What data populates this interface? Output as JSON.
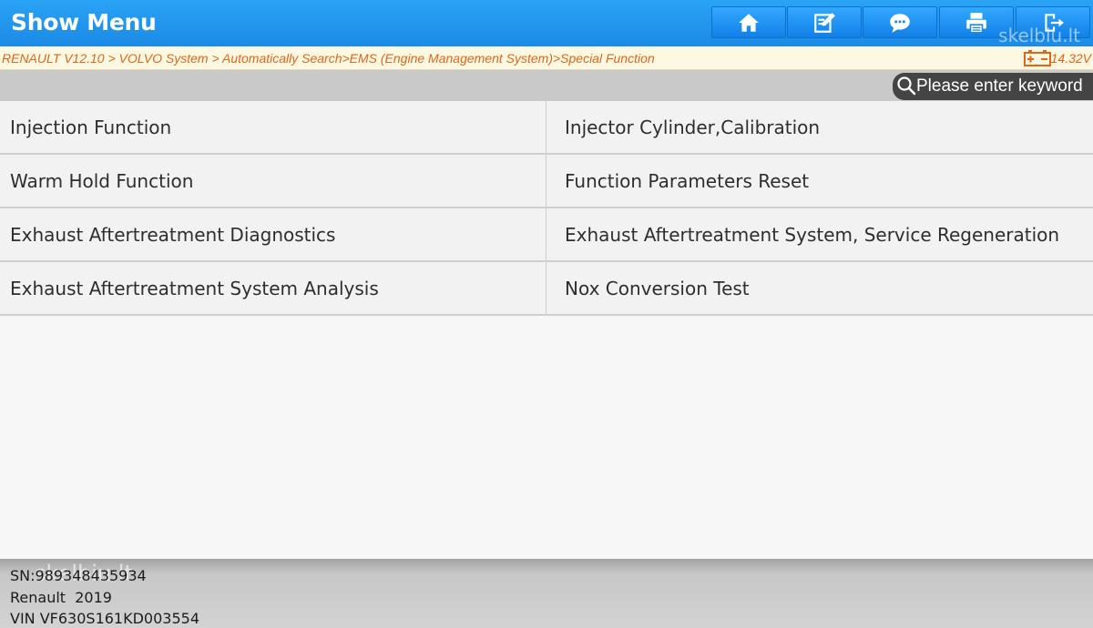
{
  "header": {
    "title": "Show Menu",
    "buttons": [
      {
        "name": "home",
        "icon": "home-icon"
      },
      {
        "name": "report",
        "icon": "edit-icon"
      },
      {
        "name": "feedback",
        "icon": "chat-icon"
      },
      {
        "name": "print",
        "icon": "print-icon"
      },
      {
        "name": "exit",
        "icon": "exit-icon"
      }
    ],
    "watermark": "skelbiu.lt"
  },
  "breadcrumb": {
    "path": "RENAULT V12.10 > VOLVO System > Automatically Search>EMS (Engine Management System)>Special Function",
    "battery_icon": "battery-icon",
    "voltage": "14.32V"
  },
  "search": {
    "placeholder": "Please enter keyword"
  },
  "menu": {
    "items": [
      "Injection Function",
      "Injector Cylinder,Calibration",
      "Warm Hold Function",
      "Function Parameters Reset",
      "Exhaust Aftertreatment Diagnostics",
      "Exhaust Aftertreatment System, Service Regeneration",
      "Exhaust Aftertreatment System Analysis",
      "Nox Conversion Test"
    ]
  },
  "footer": {
    "sn": "SN:989348435934",
    "vehicle": "Renault  2019",
    "vin": "VIN VF630S161KD003554",
    "watermark": "skelbiu.lt"
  },
  "colors": {
    "header_blue": "#1b8ae6",
    "breadcrumb_orange": "#e0661a",
    "breadcrumb_bg": "#fdf8e2"
  }
}
